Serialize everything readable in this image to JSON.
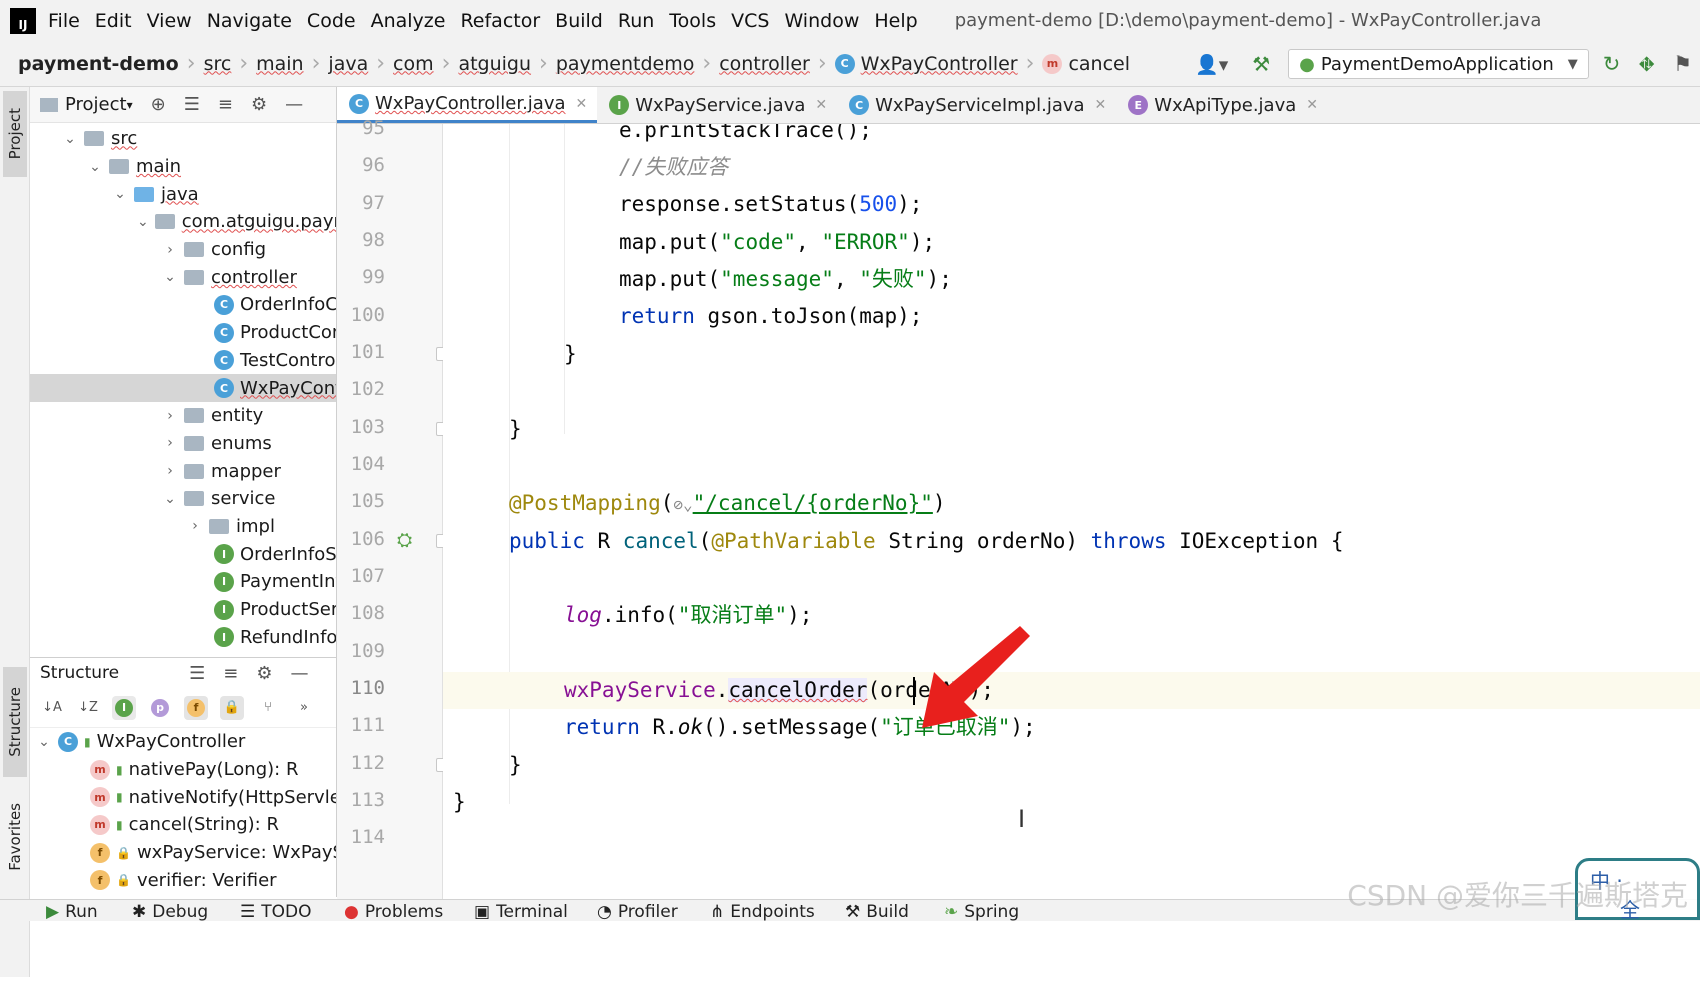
{
  "menu": {
    "logo": "IJ",
    "items": [
      "File",
      "Edit",
      "View",
      "Navigate",
      "Code",
      "Analyze",
      "Refactor",
      "Build",
      "Run",
      "Tools",
      "VCS",
      "Window",
      "Help"
    ],
    "window_title": "payment-demo [D:\\demo\\payment-demo] - WxPayController.java"
  },
  "breadcrumbs": [
    "payment-demo",
    "src",
    "main",
    "java",
    "com",
    "atguigu",
    "paymentdemo",
    "controller",
    "WxPayController",
    "cancel"
  ],
  "run_config": "PaymentDemoApplication",
  "left_strip": {
    "project": "Project",
    "structure": "Structure",
    "favorites": "Favorites"
  },
  "project_panel": {
    "title": "Project",
    "tree": [
      {
        "label": "src",
        "type": "folder",
        "expanded": true
      },
      {
        "label": "main",
        "type": "folder",
        "expanded": true
      },
      {
        "label": "java",
        "type": "folder-blue",
        "expanded": true
      },
      {
        "label": "com.atguigu.paym",
        "type": "package",
        "expanded": true
      },
      {
        "label": "config",
        "type": "package",
        "expanded": false
      },
      {
        "label": "controller",
        "type": "package",
        "expanded": true
      },
      {
        "label": "OrderInfoCo",
        "type": "class"
      },
      {
        "label": "ProductCont",
        "type": "class"
      },
      {
        "label": "TestControll",
        "type": "class"
      },
      {
        "label": "WxPayContr",
        "type": "class",
        "selected": true
      },
      {
        "label": "entity",
        "type": "package",
        "expanded": false
      },
      {
        "label": "enums",
        "type": "package",
        "expanded": false
      },
      {
        "label": "mapper",
        "type": "package",
        "expanded": false
      },
      {
        "label": "service",
        "type": "package",
        "expanded": true
      },
      {
        "label": "impl",
        "type": "package",
        "expanded": false
      },
      {
        "label": "OrderInfoSe",
        "type": "interface"
      },
      {
        "label": "PaymentInfo",
        "type": "interface"
      },
      {
        "label": "ProductServ",
        "type": "interface"
      },
      {
        "label": "RefundInfoS",
        "type": "interface"
      }
    ]
  },
  "structure_panel": {
    "title": "Structure",
    "root": "WxPayController",
    "members": [
      {
        "icon": "m",
        "label": "nativePay(Long): R"
      },
      {
        "icon": "m",
        "label": "nativeNotify(HttpServletR"
      },
      {
        "icon": "m",
        "label": "cancel(String): R"
      },
      {
        "icon": "f",
        "label": "wxPayService: WxPaySer"
      },
      {
        "icon": "f",
        "label": "verifier: Verifier"
      }
    ]
  },
  "tabs": [
    {
      "label": "WxPayController.java",
      "icon": "C",
      "active": true
    },
    {
      "label": "WxPayService.java",
      "icon": "I"
    },
    {
      "label": "WxPayServiceImpl.java",
      "icon": "C"
    },
    {
      "label": "WxApiType.java",
      "icon": "E"
    }
  ],
  "editor": {
    "line_numbers": [
      "95",
      "96",
      "97",
      "98",
      "99",
      "100",
      "101",
      "102",
      "103",
      "104",
      "105",
      "106",
      "107",
      "108",
      "109",
      "110",
      "111",
      "112",
      "113",
      "114"
    ],
    "code": {
      "l95_a": "e.printStackTrace();",
      "l96_a": "//失败应答",
      "l97_a": "response.setStatus(",
      "l97_b": "500",
      "l97_c": ");",
      "l98_a": "map.put(",
      "l98_b": "\"code\"",
      "l98_c": ", ",
      "l98_d": "\"ERROR\"",
      "l98_e": ");",
      "l99_a": "map.put(",
      "l99_b": "\"message\"",
      "l99_c": ", ",
      "l99_d": "\"失败\"",
      "l99_e": ");",
      "l100_a": "return",
      "l100_b": " gson.toJson(map);",
      "l101_a": "}",
      "l103_a": "}",
      "l105_a": "@PostMapping",
      "l105_b": "(",
      "l105_c": "\"/cancel/{orderNo}\"",
      "l105_d": ")",
      "l106_a": "public",
      "l106_b": " R ",
      "l106_c": "cancel",
      "l106_d": "(",
      "l106_e": "@PathVariable",
      "l106_f": " String orderNo) ",
      "l106_g": "throws",
      "l106_h": " IOException {",
      "l108_a": "log",
      "l108_b": ".info(",
      "l108_c": "\"取消订单\"",
      "l108_d": ");",
      "l110_a": "wxPayService",
      "l110_b": ".",
      "l110_c": "cancelOrder",
      "l110_d": "(orderNo);",
      "l111_a": "return",
      "l111_b": " R.",
      "l111_c": "ok",
      "l111_d": "().setMessage(",
      "l111_e": "\"订单已取消\"",
      "l111_f": ");",
      "l112_a": "}",
      "l113_a": "}"
    }
  },
  "bottom_tools": [
    "Run",
    "Debug",
    "TODO",
    "Problems",
    "Terminal",
    "Profiler",
    "Endpoints",
    "Build",
    "Spring"
  ],
  "watermark": "CSDN @爱你三千遍斯塔克",
  "ime": {
    "top": "中",
    "bottom": "全"
  },
  "colors": {
    "accent": "#4083c9",
    "keyword": "#0033b3",
    "string": "#067d17",
    "number": "#1750eb",
    "annotation": "#9e880d",
    "field": "#871094",
    "arrow": "#e8201d"
  }
}
